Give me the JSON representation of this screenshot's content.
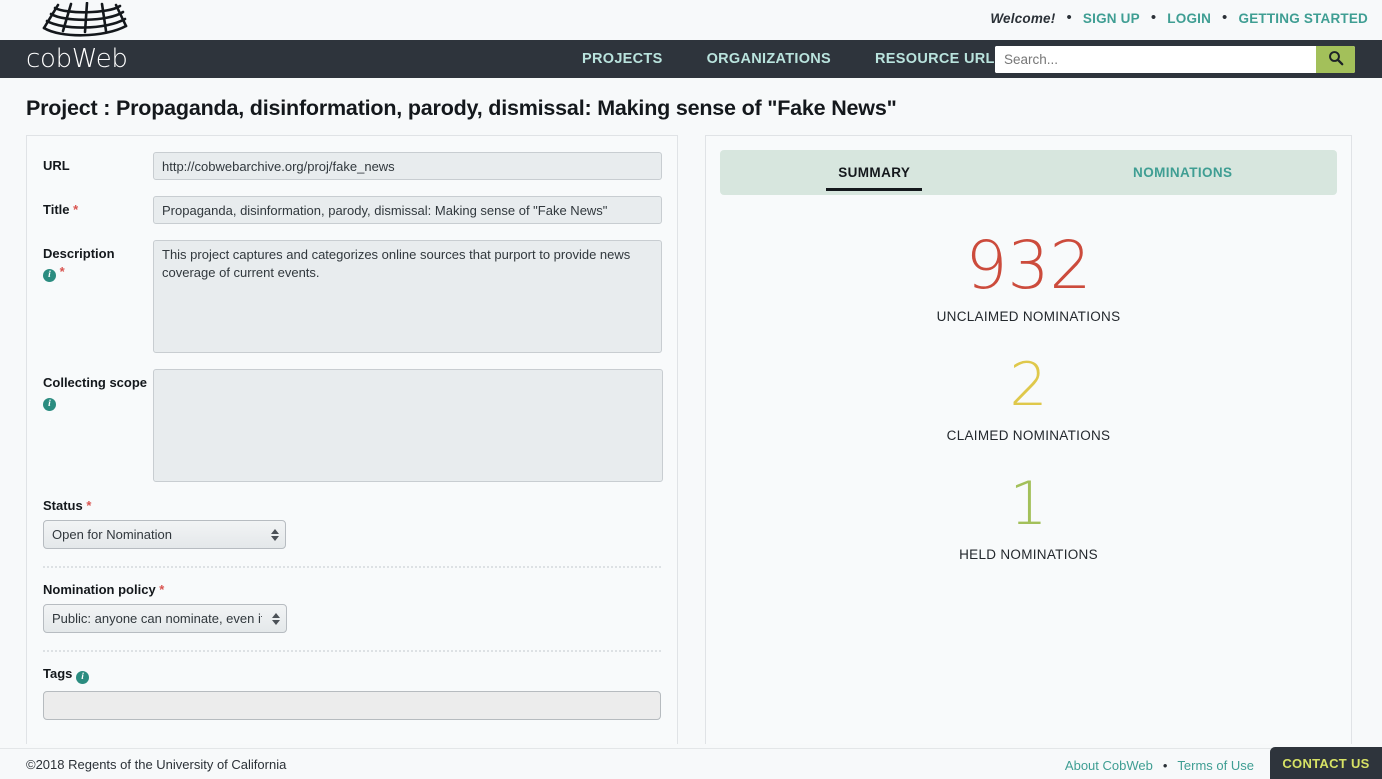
{
  "brand": {
    "logo_text": "cobWeb",
    "logo_icon": "cobweb-grid-icon"
  },
  "utility_nav": {
    "welcome": "Welcome!",
    "separator": "•",
    "links": [
      {
        "label": "SIGN UP"
      },
      {
        "label": "LOGIN"
      },
      {
        "label": "GETTING STARTED"
      }
    ]
  },
  "main_nav": {
    "links": [
      {
        "label": "PROJECTS"
      },
      {
        "label": "ORGANIZATIONS"
      },
      {
        "label": "RESOURCE URLS"
      }
    ]
  },
  "search": {
    "placeholder": "Search...",
    "value": "",
    "button_icon": "search-icon",
    "button_color": "#a3c05a"
  },
  "page": {
    "title": "Project : Propaganda, disinformation, parody, dismissal: Making sense of \"Fake News\""
  },
  "form": {
    "url": {
      "label": "URL",
      "value": "http://cobwebarchive.org/proj/fake_news",
      "placeholder": ""
    },
    "title": {
      "label": "Title",
      "required_marker": "*",
      "value": "Propaganda, disinformation, parody, dismissal: Making sense of \"Fake News\"",
      "placeholder": ""
    },
    "description": {
      "label": "Description",
      "required_marker": "*",
      "info_icon": "info-icon",
      "value": "This project captures and categorizes online sources that purport to provide news coverage of current events.",
      "placeholder": ""
    },
    "collecting_scope": {
      "label": "Collecting scope",
      "info_icon": "info-icon",
      "value": "",
      "placeholder": ""
    },
    "status": {
      "label": "Status",
      "required_marker": "*",
      "selected": "Open for Nomination"
    },
    "nomination_policy": {
      "label": "Nomination policy",
      "required_marker": "*",
      "selected": "Public: anyone can nominate, even if tl"
    },
    "tags": {
      "label": "Tags",
      "info_icon": "info-icon",
      "value": "",
      "placeholder": ""
    }
  },
  "detail_panel": {
    "tabs": [
      {
        "label": "SUMMARY",
        "active": true
      },
      {
        "label": "NOMINATIONS",
        "active": false
      }
    ],
    "stats": [
      {
        "value": "932",
        "label": "UNCLAIMED NOMINATIONS",
        "color": "#cc4b3c"
      },
      {
        "value": "2",
        "label": "CLAIMED NOMINATIONS",
        "color": "#dfc84b"
      },
      {
        "value": "1",
        "label": "HELD NOMINATIONS",
        "color": "#a3c05a"
      }
    ]
  },
  "footer": {
    "copyright": "©2018 Regents of the University of California",
    "separator": "•",
    "links": [
      {
        "label": "About CobWeb"
      },
      {
        "label": "Terms of Use"
      }
    ],
    "contact_button": "CONTACT US"
  }
}
